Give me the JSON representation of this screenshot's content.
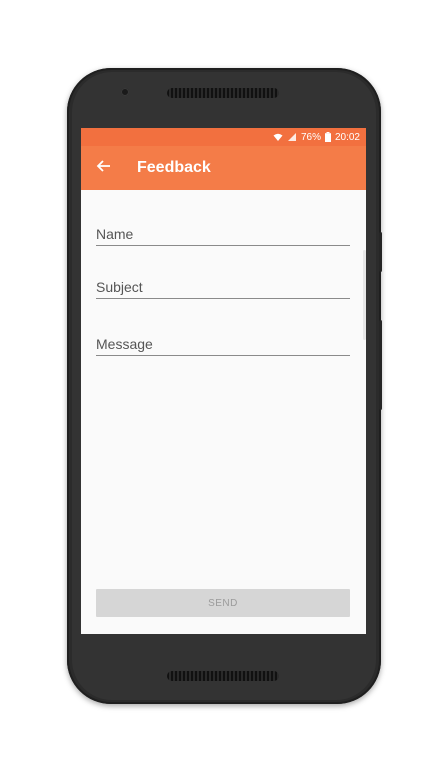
{
  "status_bar": {
    "battery": "76%",
    "time": "20:02"
  },
  "app_bar": {
    "title": "Feedback"
  },
  "form": {
    "name_placeholder": "Name",
    "subject_placeholder": "Subject",
    "message_placeholder": "Message",
    "send_label": "SEND"
  },
  "colors": {
    "accent": "#f47c48",
    "status_bar": "#f2703f",
    "send_disabled_bg": "#d6d6d6",
    "send_disabled_text": "#9b9b9b"
  },
  "icons": {
    "back": "arrow-back-icon",
    "wifi": "wifi-icon",
    "signal": "signal-icon",
    "battery": "battery-icon"
  }
}
